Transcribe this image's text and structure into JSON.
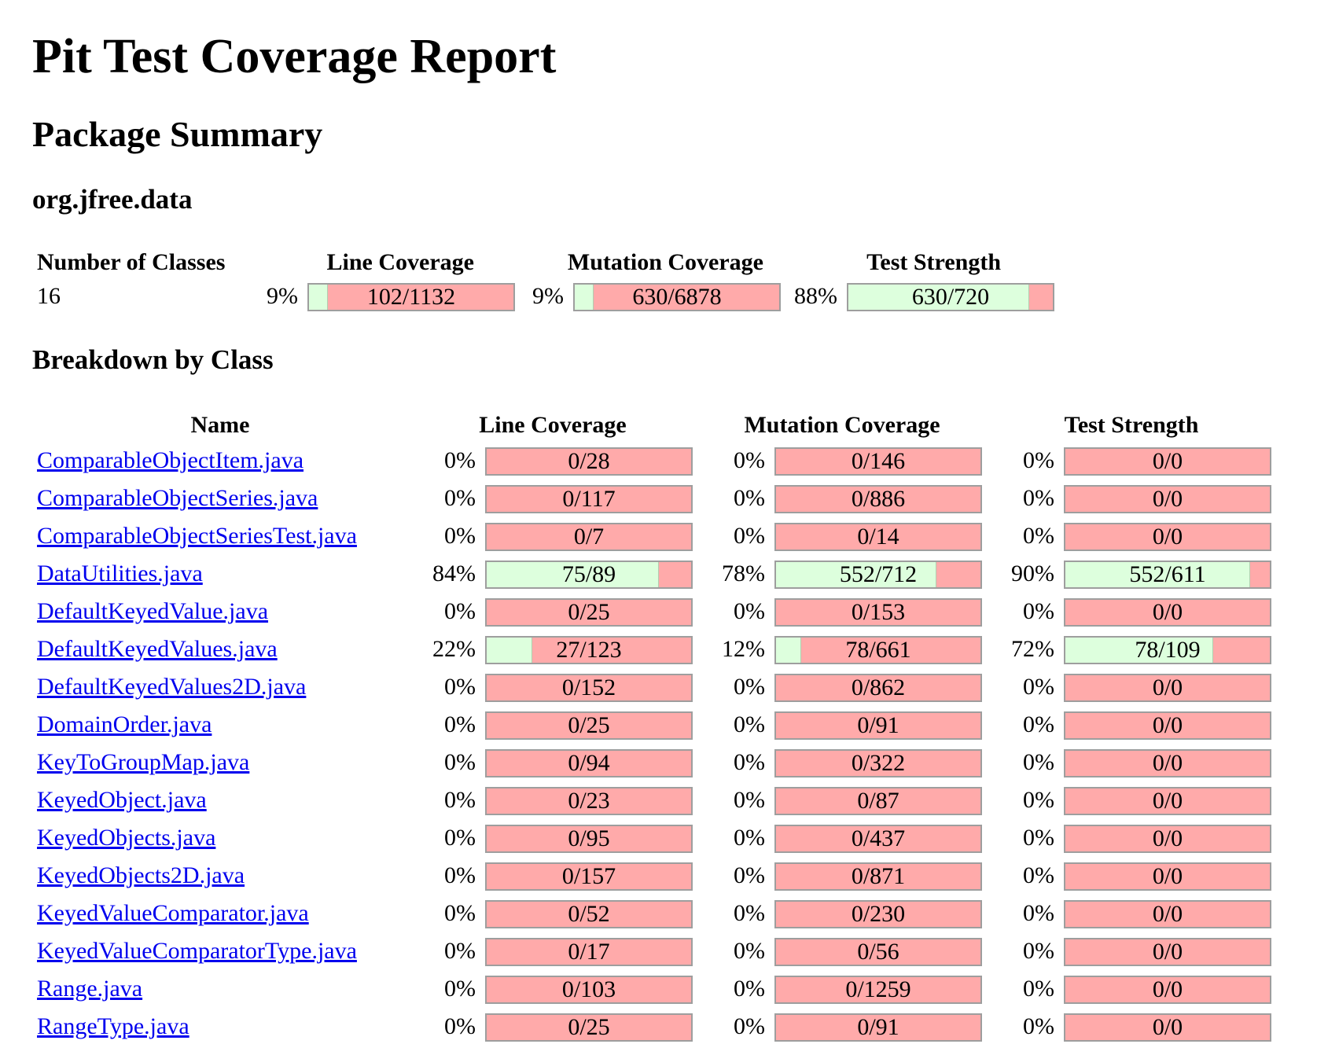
{
  "title": "Pit Test Coverage Report",
  "package_summary_heading": "Package Summary",
  "package_name": "org.jfree.data",
  "summary": {
    "headers": {
      "classes": "Number of Classes",
      "line": "Line Coverage",
      "mutation": "Mutation Coverage",
      "strength": "Test Strength"
    },
    "classes": "16",
    "line": {
      "pct": "9%",
      "ratio": "102/1132",
      "fraction": 0.09
    },
    "mutation": {
      "pct": "9%",
      "ratio": "630/6878",
      "fraction": 0.09
    },
    "strength": {
      "pct": "88%",
      "ratio": "630/720",
      "fraction": 0.88
    }
  },
  "breakdown_heading": "Breakdown by Class",
  "breakdown": {
    "headers": {
      "name": "Name",
      "line": "Line Coverage",
      "mutation": "Mutation Coverage",
      "strength": "Test Strength"
    },
    "rows": [
      {
        "name": "ComparableObjectItem.java",
        "line": {
          "pct": "0%",
          "ratio": "0/28",
          "fraction": 0
        },
        "mutation": {
          "pct": "0%",
          "ratio": "0/146",
          "fraction": 0
        },
        "strength": {
          "pct": "0%",
          "ratio": "0/0",
          "fraction": 0
        }
      },
      {
        "name": "ComparableObjectSeries.java",
        "line": {
          "pct": "0%",
          "ratio": "0/117",
          "fraction": 0
        },
        "mutation": {
          "pct": "0%",
          "ratio": "0/886",
          "fraction": 0
        },
        "strength": {
          "pct": "0%",
          "ratio": "0/0",
          "fraction": 0
        }
      },
      {
        "name": "ComparableObjectSeriesTest.java",
        "line": {
          "pct": "0%",
          "ratio": "0/7",
          "fraction": 0
        },
        "mutation": {
          "pct": "0%",
          "ratio": "0/14",
          "fraction": 0
        },
        "strength": {
          "pct": "0%",
          "ratio": "0/0",
          "fraction": 0
        }
      },
      {
        "name": "DataUtilities.java",
        "line": {
          "pct": "84%",
          "ratio": "75/89",
          "fraction": 0.84
        },
        "mutation": {
          "pct": "78%",
          "ratio": "552/712",
          "fraction": 0.78
        },
        "strength": {
          "pct": "90%",
          "ratio": "552/611",
          "fraction": 0.9
        }
      },
      {
        "name": "DefaultKeyedValue.java",
        "line": {
          "pct": "0%",
          "ratio": "0/25",
          "fraction": 0
        },
        "mutation": {
          "pct": "0%",
          "ratio": "0/153",
          "fraction": 0
        },
        "strength": {
          "pct": "0%",
          "ratio": "0/0",
          "fraction": 0
        }
      },
      {
        "name": "DefaultKeyedValues.java",
        "line": {
          "pct": "22%",
          "ratio": "27/123",
          "fraction": 0.22
        },
        "mutation": {
          "pct": "12%",
          "ratio": "78/661",
          "fraction": 0.12
        },
        "strength": {
          "pct": "72%",
          "ratio": "78/109",
          "fraction": 0.72
        }
      },
      {
        "name": "DefaultKeyedValues2D.java",
        "line": {
          "pct": "0%",
          "ratio": "0/152",
          "fraction": 0
        },
        "mutation": {
          "pct": "0%",
          "ratio": "0/862",
          "fraction": 0
        },
        "strength": {
          "pct": "0%",
          "ratio": "0/0",
          "fraction": 0
        }
      },
      {
        "name": "DomainOrder.java",
        "line": {
          "pct": "0%",
          "ratio": "0/25",
          "fraction": 0
        },
        "mutation": {
          "pct": "0%",
          "ratio": "0/91",
          "fraction": 0
        },
        "strength": {
          "pct": "0%",
          "ratio": "0/0",
          "fraction": 0
        }
      },
      {
        "name": "KeyToGroupMap.java",
        "line": {
          "pct": "0%",
          "ratio": "0/94",
          "fraction": 0
        },
        "mutation": {
          "pct": "0%",
          "ratio": "0/322",
          "fraction": 0
        },
        "strength": {
          "pct": "0%",
          "ratio": "0/0",
          "fraction": 0
        }
      },
      {
        "name": "KeyedObject.java",
        "line": {
          "pct": "0%",
          "ratio": "0/23",
          "fraction": 0
        },
        "mutation": {
          "pct": "0%",
          "ratio": "0/87",
          "fraction": 0
        },
        "strength": {
          "pct": "0%",
          "ratio": "0/0",
          "fraction": 0
        }
      },
      {
        "name": "KeyedObjects.java",
        "line": {
          "pct": "0%",
          "ratio": "0/95",
          "fraction": 0
        },
        "mutation": {
          "pct": "0%",
          "ratio": "0/437",
          "fraction": 0
        },
        "strength": {
          "pct": "0%",
          "ratio": "0/0",
          "fraction": 0
        }
      },
      {
        "name": "KeyedObjects2D.java",
        "line": {
          "pct": "0%",
          "ratio": "0/157",
          "fraction": 0
        },
        "mutation": {
          "pct": "0%",
          "ratio": "0/871",
          "fraction": 0
        },
        "strength": {
          "pct": "0%",
          "ratio": "0/0",
          "fraction": 0
        }
      },
      {
        "name": "KeyedValueComparator.java",
        "line": {
          "pct": "0%",
          "ratio": "0/52",
          "fraction": 0
        },
        "mutation": {
          "pct": "0%",
          "ratio": "0/230",
          "fraction": 0
        },
        "strength": {
          "pct": "0%",
          "ratio": "0/0",
          "fraction": 0
        }
      },
      {
        "name": "KeyedValueComparatorType.java",
        "line": {
          "pct": "0%",
          "ratio": "0/17",
          "fraction": 0
        },
        "mutation": {
          "pct": "0%",
          "ratio": "0/56",
          "fraction": 0
        },
        "strength": {
          "pct": "0%",
          "ratio": "0/0",
          "fraction": 0
        }
      },
      {
        "name": "Range.java",
        "line": {
          "pct": "0%",
          "ratio": "0/103",
          "fraction": 0
        },
        "mutation": {
          "pct": "0%",
          "ratio": "0/1259",
          "fraction": 0
        },
        "strength": {
          "pct": "0%",
          "ratio": "0/0",
          "fraction": 0
        }
      },
      {
        "name": "RangeType.java",
        "line": {
          "pct": "0%",
          "ratio": "0/25",
          "fraction": 0
        },
        "mutation": {
          "pct": "0%",
          "ratio": "0/91",
          "fraction": 0
        },
        "strength": {
          "pct": "0%",
          "ratio": "0/0",
          "fraction": 0
        }
      }
    ]
  },
  "colors": {
    "covered": "#ddffdd",
    "uncovered": "#ffaaaa",
    "link": "#0000ee"
  }
}
